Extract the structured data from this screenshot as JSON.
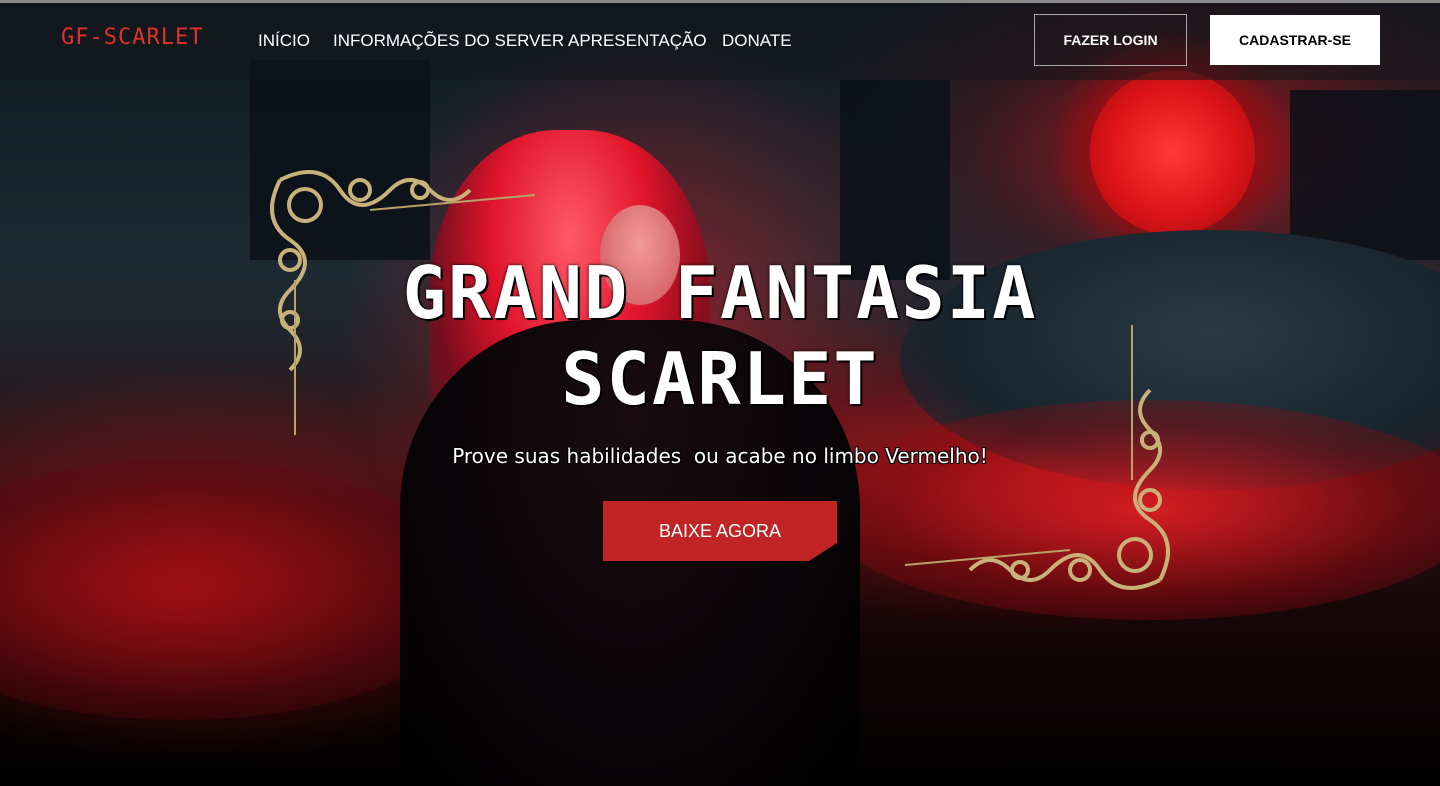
{
  "nav": {
    "logo": "GF-SCARLET",
    "links": [
      "INÍCIO",
      "INFORMAÇÕES DO SERVER",
      "APRESENTAÇÃO",
      "DONATE"
    ],
    "login_label": "FAZER LOGIN",
    "signup_label": "CADASTRAR-SE"
  },
  "hero": {
    "title_line1": "GRAND FANTASIA",
    "title_line2": "SCARLET",
    "subtitle": "Prove suas habilidades  ou acabe no limbo Vermelho!",
    "cta_label": "BAIXE AGORA"
  },
  "colors": {
    "accent": "#c02424",
    "logo": "#e0322a",
    "gold": "#c9b27a"
  }
}
